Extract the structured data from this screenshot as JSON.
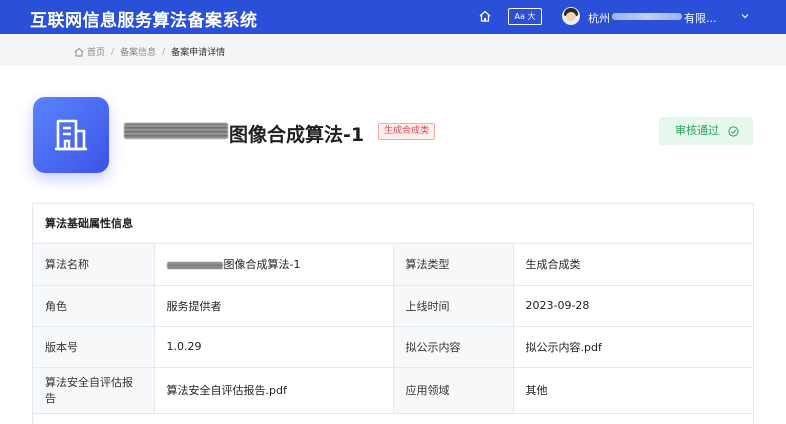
{
  "header": {
    "system_title": "互联网信息服务算法备案系统",
    "font_button": "Aa 大",
    "user_prefix": "杭州",
    "user_suffix": "有限...",
    "brand_color": "#2a4fd8"
  },
  "breadcrumb": {
    "items": [
      "首页",
      "备案信息",
      "备案申请详情"
    ],
    "separator": "/"
  },
  "algorithm": {
    "title": "图像合成算法-1",
    "type_badge": "生成合成类",
    "status": "审核通过",
    "status_color": "#26a65b"
  },
  "info_card": {
    "title": "算法基础属性信息",
    "rows": [
      {
        "label1": "算法名称",
        "value1": "图像合成算法-1",
        "label2": "算法类型",
        "value2": "生成合成类"
      },
      {
        "label1": "角色",
        "value1": "服务提供者",
        "label2": "上线时间",
        "value2": "2023-09-28"
      },
      {
        "label1": "版本号",
        "value1": "1.0.29",
        "label2": "拟公示内容",
        "value2": "拟公示内容.pdf"
      },
      {
        "label1": "算法安全自评估报告",
        "value1": "算法安全自评估报告.pdf",
        "label2": "应用领域",
        "value2": "其他"
      }
    ]
  },
  "icons": {
    "home": "home-icon",
    "font_size": "font-size-icon",
    "user": "avatar",
    "dropdown": "chevron-down-icon",
    "algorithm": "building-icon",
    "status": "check-circle-icon"
  }
}
